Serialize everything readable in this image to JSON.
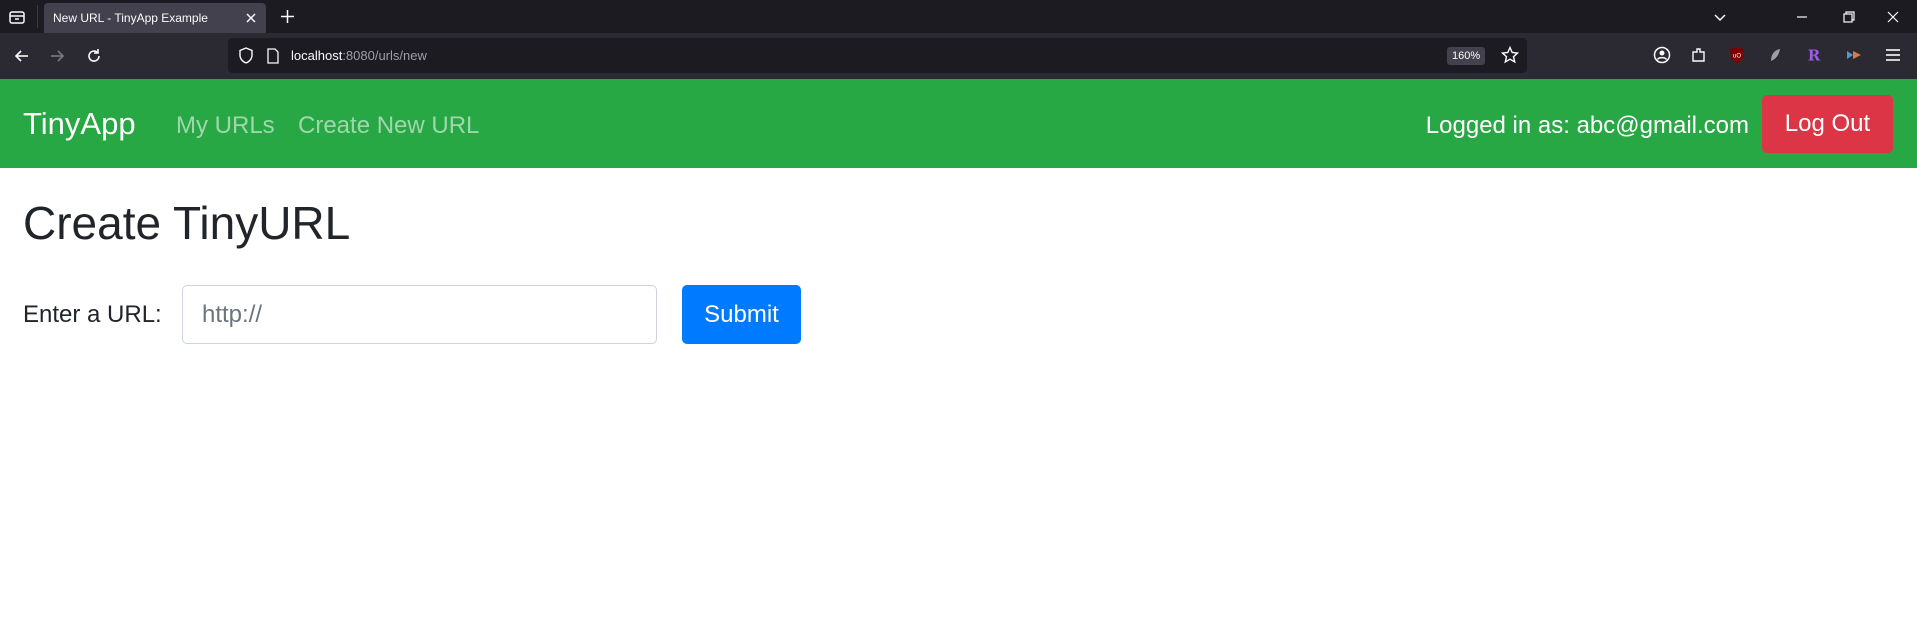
{
  "browser": {
    "tab_title": "New URL - TinyApp Example",
    "url_host": "localhost",
    "url_rest": ":8080/urls/new",
    "zoom": "160%"
  },
  "app": {
    "brand": "TinyApp",
    "nav_links": [
      "My URLs",
      "Create New URL"
    ],
    "logged_in_text": "Logged in as: abc@gmail.com",
    "logout_label": "Log Out",
    "colors": {
      "navbar": "#28a745",
      "logout": "#dc3545",
      "submit": "#007bff"
    }
  },
  "form": {
    "heading": "Create TinyURL",
    "label": "Enter a URL:",
    "placeholder": "http://",
    "submit_label": "Submit"
  }
}
